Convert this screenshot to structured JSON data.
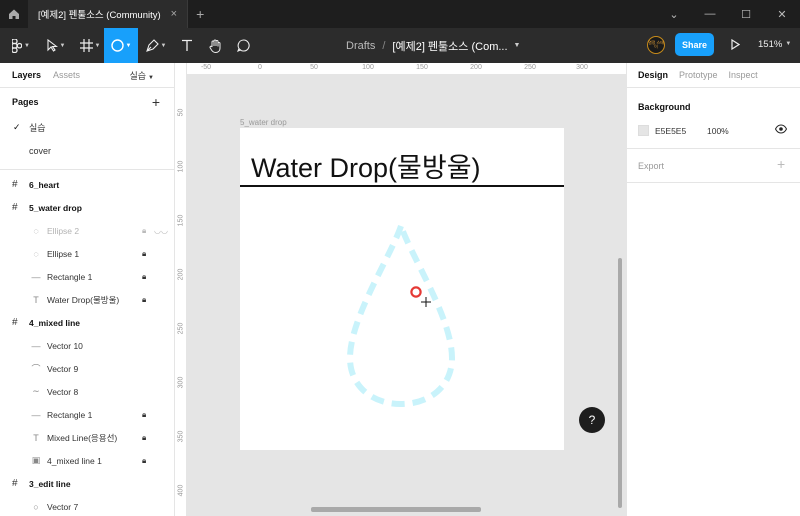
{
  "titlebar": {
    "tab_title": "[예제2] 펜툴소스 (Community)",
    "new_tab": "+",
    "close": "×",
    "minimize": "—",
    "maximize": "☐",
    "close_window": "✕"
  },
  "toolbar": {
    "breadcrumb": "Drafts",
    "separator": "/",
    "file_name": "[예제2] 펜툴소스 (Com...",
    "share_label": "Share",
    "zoom": "151%",
    "avatar_text": "열정 스테이"
  },
  "left_panel": {
    "tabs": [
      "Layers",
      "Assets"
    ],
    "current_page_selector": "실습",
    "pages_label": "Pages",
    "pages": [
      {
        "name": "실습",
        "selected": true
      },
      {
        "name": "cover",
        "selected": false
      }
    ],
    "layers": [
      {
        "name": "6_heart",
        "type": "frame"
      },
      {
        "name": "5_water drop",
        "type": "frame"
      },
      {
        "name": "Ellipse 2",
        "type": "ellipse",
        "locked": true,
        "hidden": true
      },
      {
        "name": "Ellipse 1",
        "type": "ellipse",
        "locked": true
      },
      {
        "name": "Rectangle 1",
        "type": "rect",
        "locked": true
      },
      {
        "name": "Water Drop(물방울)",
        "type": "text",
        "locked": true
      },
      {
        "name": "4_mixed line",
        "type": "frame"
      },
      {
        "name": "Vector 10",
        "type": "vector"
      },
      {
        "name": "Vector 9",
        "type": "vector"
      },
      {
        "name": "Vector 8",
        "type": "vector"
      },
      {
        "name": "Rectangle 1",
        "type": "rect",
        "locked": true
      },
      {
        "name": "Mixed Line(응용선)",
        "type": "text",
        "locked": true
      },
      {
        "name": "4_mixed line 1",
        "type": "image",
        "locked": true
      },
      {
        "name": "3_edit line",
        "type": "frame"
      },
      {
        "name": "Vector 7",
        "type": "vector"
      }
    ]
  },
  "canvas": {
    "ruler_top": [
      "-50",
      "0",
      "50",
      "100",
      "150",
      "200",
      "250",
      "300"
    ],
    "ruler_left": [
      "50",
      "100",
      "150",
      "200",
      "250",
      "300",
      "350",
      "400"
    ],
    "frame_label": "5_water drop",
    "frame_title": "Water Drop(물방울)",
    "help": "?"
  },
  "right_panel": {
    "tabs": [
      "Design",
      "Prototype",
      "Inspect"
    ],
    "background_label": "Background",
    "background_hex": "E5E5E5",
    "background_opacity": "100%",
    "export_label": "Export",
    "export_plus": "+"
  },
  "colors": {
    "accent": "#18a0fb",
    "drop_stroke": "#c9f3fb",
    "cursor_ring": "#e53935",
    "dark_bar": "#2c2c2c"
  }
}
